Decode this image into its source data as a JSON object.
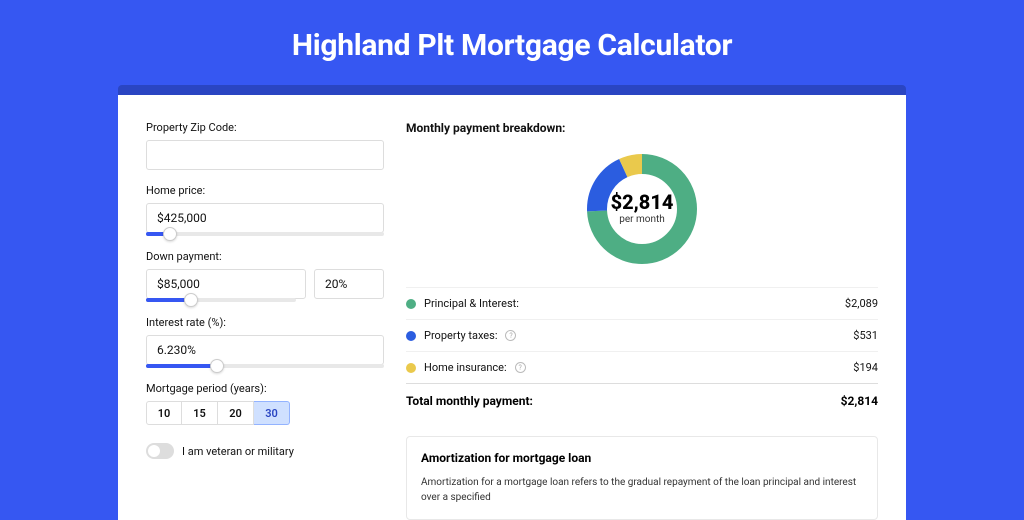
{
  "title": "Highland Plt Mortgage Calculator",
  "form": {
    "zip_label": "Property Zip Code:",
    "zip_value": "",
    "home_price_label": "Home price:",
    "home_price_value": "$425,000",
    "home_price_slider_pct": 10,
    "down_payment_label": "Down payment:",
    "down_payment_value": "$85,000",
    "down_payment_pct": "20%",
    "down_payment_slider_pct": 20,
    "interest_label": "Interest rate (%):",
    "interest_value": "6.230%",
    "interest_slider_pct": 30,
    "period_label": "Mortgage period (years):",
    "periods": [
      "10",
      "15",
      "20",
      "30"
    ],
    "period_active": "30",
    "veteran_label": "I am veteran or military"
  },
  "breakdown": {
    "title": "Monthly payment breakdown:",
    "center_amount": "$2,814",
    "center_sub": "per month",
    "rows": [
      {
        "label": "Principal & Interest:",
        "value": "$2,089",
        "color": "green",
        "info": false
      },
      {
        "label": "Property taxes:",
        "value": "$531",
        "color": "blue",
        "info": true
      },
      {
        "label": "Home insurance:",
        "value": "$194",
        "color": "yellow",
        "info": true
      }
    ],
    "total_label": "Total monthly payment:",
    "total_value": "$2,814"
  },
  "amort": {
    "title": "Amortization for mortgage loan",
    "text": "Amortization for a mortgage loan refers to the gradual repayment of the loan principal and interest over a specified"
  },
  "chart_data": {
    "type": "pie",
    "title": "Monthly payment breakdown",
    "series": [
      {
        "name": "Principal & Interest",
        "value": 2089,
        "color": "#4eae84"
      },
      {
        "name": "Property taxes",
        "value": 531,
        "color": "#2b5de0"
      },
      {
        "name": "Home insurance",
        "value": 194,
        "color": "#eac94c"
      }
    ],
    "total": 2814,
    "center_label": "$2,814 per month"
  }
}
